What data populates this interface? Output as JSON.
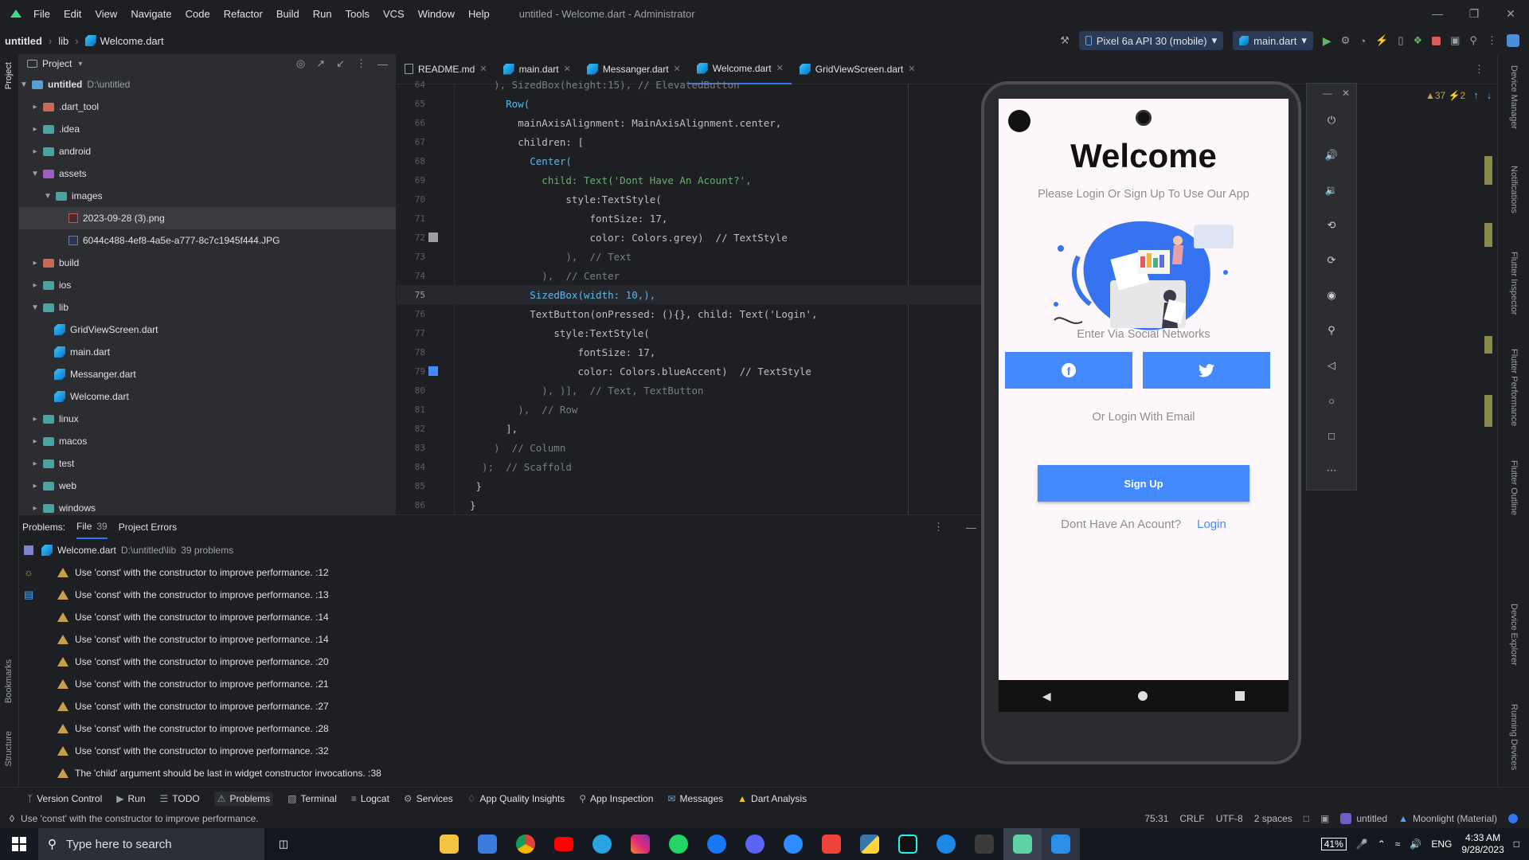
{
  "titlebar": {
    "menu": [
      "File",
      "Edit",
      "View",
      "Navigate",
      "Code",
      "Refactor",
      "Build",
      "Run",
      "Tools",
      "VCS",
      "Window",
      "Help"
    ],
    "title": "untitled - Welcome.dart - Administrator"
  },
  "navbar": {
    "project": "untitled",
    "crumb_lib": "lib",
    "crumb_file": "Welcome.dart",
    "device": "Pixel 6a API 30 (mobile)",
    "run_config": "main.dart"
  },
  "leftstrip": {
    "project_label": "Project",
    "bookmarks_label": "Bookmarks",
    "structure_label": "Structure"
  },
  "project_panel": {
    "title": "Project",
    "tree": [
      {
        "label": "untitled",
        "extra": "D:\\untitled",
        "type": "root"
      },
      {
        "label": ".dart_tool",
        "type": "folder"
      },
      {
        "label": ".idea",
        "type": "folder"
      },
      {
        "label": "android",
        "type": "folder"
      },
      {
        "label": "assets",
        "type": "folder"
      },
      {
        "label": "images",
        "type": "folder"
      },
      {
        "label": "2023-09-28 (3).png",
        "type": "image"
      },
      {
        "label": "6044c488-4ef8-4a5e-a777-8c7c1945f444.JPG",
        "type": "image"
      },
      {
        "label": "build",
        "type": "folder"
      },
      {
        "label": "ios",
        "type": "folder"
      },
      {
        "label": "lib",
        "type": "folder"
      },
      {
        "label": "GridViewScreen.dart",
        "type": "dart"
      },
      {
        "label": "main.dart",
        "type": "dart"
      },
      {
        "label": "Messanger.dart",
        "type": "dart"
      },
      {
        "label": "Welcome.dart",
        "type": "dart"
      },
      {
        "label": "linux",
        "type": "folder"
      },
      {
        "label": "macos",
        "type": "folder"
      },
      {
        "label": "test",
        "type": "folder"
      },
      {
        "label": "web",
        "type": "folder"
      },
      {
        "label": "windows",
        "type": "folder"
      }
    ]
  },
  "tabs": [
    "README.md",
    "main.dart",
    "Messanger.dart",
    "Welcome.dart",
    "GridViewScreen.dart"
  ],
  "editor": {
    "inspection": "▲37  ⚡2",
    "lines": [
      {
        "n": "64",
        "text": "    ), SizedBox(height:15), // ElevatedButton"
      },
      {
        "n": "65",
        "text": "      Row("
      },
      {
        "n": "66",
        "text": "        mainAxisAlignment: MainAxisAlignment.center,"
      },
      {
        "n": "67",
        "text": "        children: ["
      },
      {
        "n": "68",
        "text": "          Center("
      },
      {
        "n": "69",
        "text": "            child: Text('Dont Have An Acount?',"
      },
      {
        "n": "70",
        "text": "                style:TextStyle("
      },
      {
        "n": "71",
        "text": "                    fontSize: 17,"
      },
      {
        "n": "72",
        "text": "                    color: Colors.grey)  // TextStyle"
      },
      {
        "n": "73",
        "text": "                ),  // Text"
      },
      {
        "n": "74",
        "text": "            ),  // Center"
      },
      {
        "n": "75",
        "text": "          SizedBox(width: 10,),"
      },
      {
        "n": "76",
        "text": "          TextButton(onPressed: (){}, child: Text('Login',"
      },
      {
        "n": "77",
        "text": "              style:TextStyle("
      },
      {
        "n": "78",
        "text": "                  fontSize: 17,"
      },
      {
        "n": "79",
        "text": "                  color: Colors.blueAccent)  // TextStyle"
      },
      {
        "n": "80",
        "text": "            ), )],  // Text, TextButton"
      },
      {
        "n": "81",
        "text": "        ),  // Row"
      },
      {
        "n": "82",
        "text": "      ],"
      },
      {
        "n": "83",
        "text": "    )  // Column"
      },
      {
        "n": "84",
        "text": "  );  // Scaffold"
      },
      {
        "n": "85",
        "text": " }"
      },
      {
        "n": "86",
        "text": "}"
      }
    ]
  },
  "problems": {
    "label": "Problems:",
    "tab_file": "File",
    "tab_file_count": "39",
    "tab_project": "Project Errors",
    "file": "Welcome.dart",
    "file_path": "D:\\untitled\\lib",
    "file_count": "39 problems",
    "items": [
      "Use 'const' with the constructor to improve performance. :12",
      "Use 'const' with the constructor to improve performance. :13",
      "Use 'const' with the constructor to improve performance. :14",
      "Use 'const' with the constructor to improve performance. :14",
      "Use 'const' with the constructor to improve performance. :20",
      "Use 'const' with the constructor to improve performance. :21",
      "Use 'const' with the constructor to improve performance. :27",
      "Use 'const' with the constructor to improve performance. :28",
      "Use 'const' with the constructor to improve performance. :32",
      "The 'child' argument should be last in widget constructor invocations. :38"
    ]
  },
  "app": {
    "title": "Welcome",
    "subtitle": "Please Login Or Sign Up To Use Our App",
    "social_label": "Enter Via Social Networks",
    "email_label": "Or Login With Email",
    "signup": "Sign Up",
    "no_account": "Dont Have An Acount?",
    "login": "Login"
  },
  "rightstrip": [
    "Device Manager",
    "Notifications",
    "Flutter Inspector",
    "Flutter Performance",
    "Flutter Outline",
    "Device Explorer",
    "Running Devices"
  ],
  "bottom_tools": [
    "Version Control",
    "Run",
    "TODO",
    "Problems",
    "Terminal",
    "Logcat",
    "Services",
    "App Quality Insights",
    "App Inspection",
    "Messages",
    "Dart Analysis"
  ],
  "status": {
    "message": "Use 'const' with the constructor to improve performance.",
    "position": "75:31",
    "line_sep": "CRLF",
    "encoding": "UTF-8",
    "indent": "2 spaces",
    "project": "untitled",
    "theme": "Moonlight (Material)"
  },
  "taskbar": {
    "search_placeholder": "Type here to search",
    "battery": "41%",
    "lang": "ENG",
    "time": "4:33 AM",
    "date": "9/28/2023",
    "apps": [
      "file-explorer",
      "store",
      "chrome",
      "youtube",
      "telegram",
      "instagram",
      "whatsapp",
      "facebook",
      "discord",
      "zoom",
      "anydesk",
      "python",
      "tiktok",
      "app-store",
      "unity",
      "android-studio",
      "flutter-app"
    ]
  },
  "colors": {
    "accent": "#3574f0",
    "button_blue": "#448aff",
    "bg": "#1e1f22",
    "panel": "#2b2d30"
  }
}
